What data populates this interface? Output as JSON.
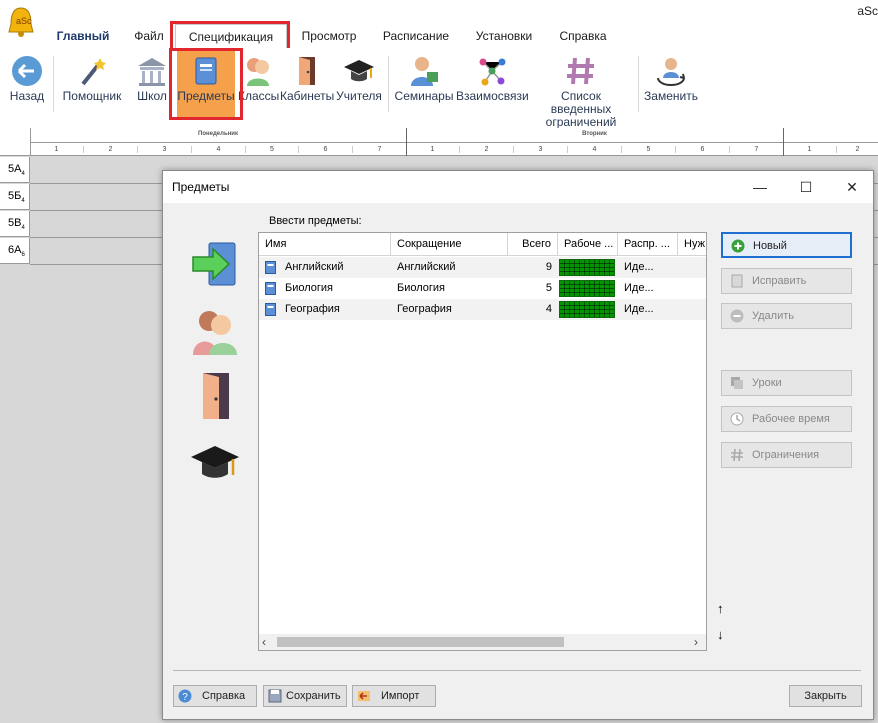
{
  "app": {
    "title": "aSc"
  },
  "tabs": [
    "Главный",
    "Файл",
    "Спецификация",
    "Просмотр",
    "Расписание",
    "Установки",
    "Справка"
  ],
  "ribbon": [
    "Назад",
    "Помощник",
    "Школ",
    "Предметы",
    "Классы",
    "Кабинеты",
    "Учителя",
    "Семинары",
    "Взаимосвязи",
    "Список введенных ограничений",
    "Заменить"
  ],
  "grid": {
    "days": [
      "Понедельник",
      "Вторник"
    ],
    "periods": [
      "1",
      "2",
      "3",
      "4",
      "5",
      "6",
      "7"
    ],
    "rows": [
      {
        "name": "5А",
        "sub": "4"
      },
      {
        "name": "5Б",
        "sub": "4"
      },
      {
        "name": "5В",
        "sub": "4"
      },
      {
        "name": "6А",
        "sub": "6"
      }
    ]
  },
  "dialog": {
    "title": "Предметы",
    "section_label": "Ввести предметы:",
    "columns": [
      "Имя",
      "Сокращение",
      "Всего",
      "Рабоче ...",
      "Распр. ...",
      "Нуж"
    ],
    "rows": [
      {
        "name": "Английский",
        "short": "Английский",
        "total": "9",
        "dist": "Иде..."
      },
      {
        "name": "Биология",
        "short": "Биология",
        "total": "5",
        "dist": "Иде..."
      },
      {
        "name": "География",
        "short": "География",
        "total": "4",
        "dist": "Иде..."
      }
    ],
    "side_buttons": [
      "Новый",
      "Исправить",
      "Удалить",
      "Уроки",
      "Рабочее время",
      "Ограничения"
    ],
    "bottom": {
      "help": "Справка",
      "save": "Сохранить",
      "import": "Импорт",
      "close": "Закрыть"
    }
  },
  "colors": {
    "highlight": "#e2262d",
    "accent": "#1e6fcf",
    "green_cells": "#21c21f",
    "active_ribbon": "#f5a04a"
  }
}
